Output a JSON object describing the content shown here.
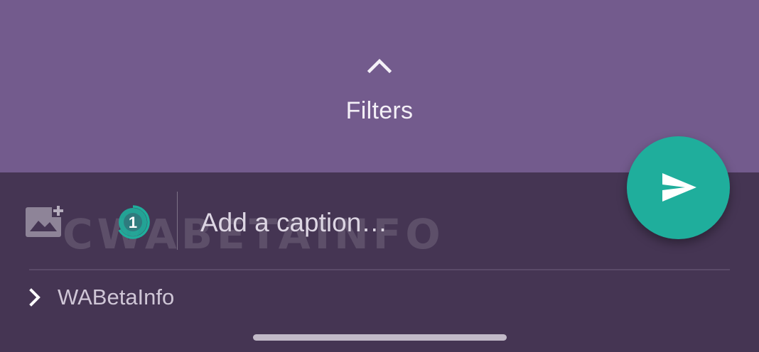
{
  "filters": {
    "label": "Filters",
    "icon": "chevron-up-icon"
  },
  "composer": {
    "caption_placeholder": "Add a caption…",
    "caption_value": "",
    "add_media_icon": "add-photo-icon",
    "view_once": {
      "icon": "view-once-icon",
      "number": "1"
    },
    "send_icon": "send-icon"
  },
  "recipient": {
    "name": "WABetaInfo",
    "icon": "chevron-right-icon"
  },
  "watermark": {
    "text": "CWABETAINFO"
  },
  "colors": {
    "top_background": "#735b8d",
    "bottom_background": "#453553",
    "accent": "#1fae9c",
    "home_indicator": "#c2bac8"
  }
}
